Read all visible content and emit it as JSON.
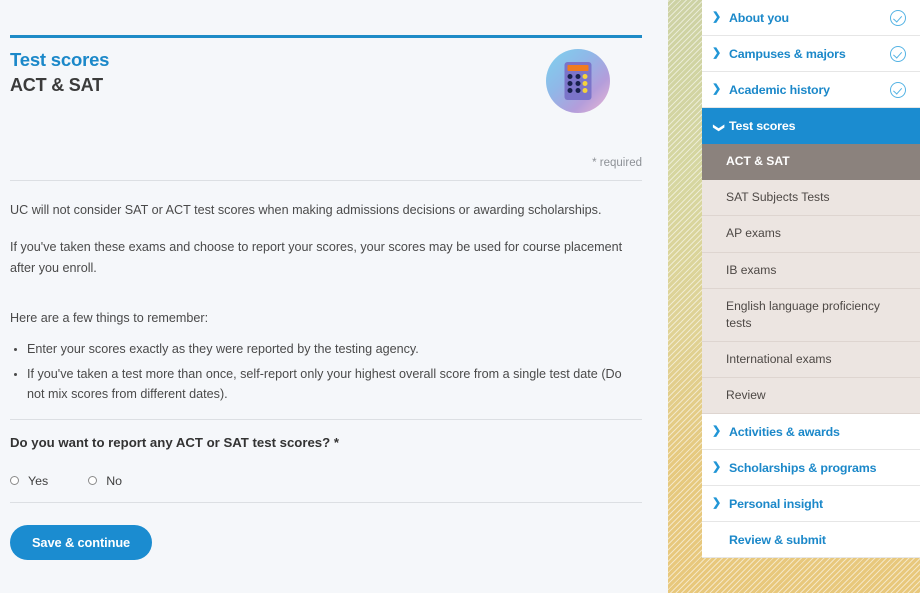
{
  "header": {
    "eyebrow": "Test scores",
    "title": "ACT & SAT",
    "icon": "calculator-icon",
    "required_note": "* required"
  },
  "content": {
    "paragraphs": [
      "UC will not consider SAT or ACT test scores when making admissions decisions or awarding scholarships.",
      "If you've taken these exams and choose to report your scores, your scores may be used for course placement after you enroll.",
      "Here are a few things to remember:"
    ],
    "bullets": [
      "Enter your scores exactly as they were reported by the testing agency.",
      "If you've taken a test more than once, self-report only your highest overall score from a single test date (Do not mix scores from different dates)."
    ],
    "question": "Do you want to report any ACT or SAT test scores? *",
    "radio_options": [
      {
        "label": "Yes",
        "selected": false
      },
      {
        "label": "No",
        "selected": false
      }
    ],
    "submit_label": "Save & continue"
  },
  "sidebar": {
    "items": [
      {
        "label": "About you",
        "type": "section",
        "chevron": "chevron-right",
        "complete": true
      },
      {
        "label": "Campuses & majors",
        "type": "section",
        "chevron": "chevron-right",
        "complete": true
      },
      {
        "label": "Academic history",
        "type": "section",
        "chevron": "chevron-right",
        "complete": true
      },
      {
        "label": "Test scores",
        "type": "section",
        "chevron": "chevron-down",
        "complete": false,
        "active": true
      }
    ],
    "sub_items": [
      {
        "label": "ACT & SAT",
        "current": true
      },
      {
        "label": "SAT Subjects Tests",
        "current": false
      },
      {
        "label": "AP exams",
        "current": false
      },
      {
        "label": "IB exams",
        "current": false
      },
      {
        "label": "English language proficiency tests",
        "current": false
      },
      {
        "label": "International exams",
        "current": false
      },
      {
        "label": "Review",
        "current": false
      }
    ],
    "items_after": [
      {
        "label": "Activities & awards",
        "type": "section",
        "chevron": "chevron-right",
        "complete": false
      },
      {
        "label": "Scholarships & programs",
        "type": "section",
        "chevron": "chevron-right",
        "complete": false
      },
      {
        "label": "Personal insight",
        "type": "section",
        "chevron": "chevron-right",
        "complete": false
      },
      {
        "label": "Review & submit",
        "type": "link",
        "chevron": "",
        "complete": false
      }
    ]
  },
  "colors": {
    "accent_blue": "#1b8cd0",
    "link_blue": "#1b88c9",
    "current_sub": "#8b827d",
    "sub_bg": "#ece5e1",
    "band_top": "#cdd2a4",
    "band_bottom": "#e8c87c"
  }
}
